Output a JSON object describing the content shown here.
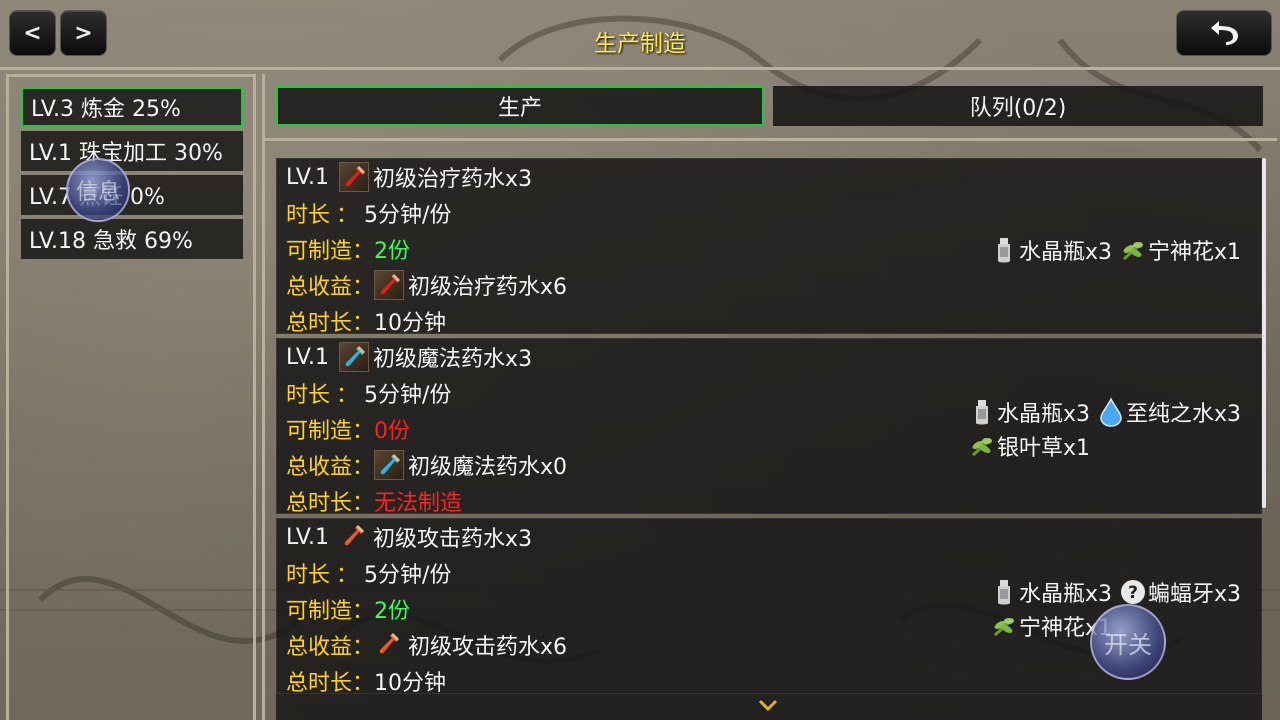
{
  "header": {
    "title": "生产制造",
    "prev_label": "<",
    "next_label": ">",
    "back_icon": "undo-arrow-icon"
  },
  "sidebar": {
    "items": [
      {
        "label": "LV.3 炼金 25%",
        "active": true
      },
      {
        "label": "LV.1 珠宝加工 30%",
        "active": false
      },
      {
        "label": "LV.7 烹饪 0%",
        "active": false
      },
      {
        "label": "LV.18 急救 69%",
        "active": false
      }
    ],
    "info_bubble_label": "信息"
  },
  "tabs": {
    "produce": "生产",
    "queue": "队列(0/2)"
  },
  "labels": {
    "duration": "时长",
    "colon_spaced": "：",
    "craftable": "可制造：",
    "total_yield": "总收益：",
    "total_time": "总时长："
  },
  "recipes": [
    {
      "level": "LV.1",
      "name": "初级治疗药水x3",
      "duration": "5分钟/份",
      "craftable": "2份",
      "yield": "初级治疗药水x6",
      "total_time": "10分钟",
      "icon": "red-potion-icon",
      "materials": [
        {
          "name": "水晶瓶x3",
          "icon": "crystal-vial-icon"
        },
        {
          "name": "宁神花x1",
          "icon": "herb-icon"
        }
      ]
    },
    {
      "level": "LV.1",
      "name": "初级魔法药水x3",
      "duration": "5分钟/份",
      "craftable": "0份",
      "yield": "初级魔法药水x0",
      "total_time": "无法制造",
      "icon": "blue-potion-icon",
      "materials": [
        {
          "name": "水晶瓶x3",
          "icon": "crystal-vial-icon"
        },
        {
          "name": "至纯之水x3",
          "icon": "water-drop-icon"
        },
        {
          "name": "银叶草x1",
          "icon": "herb-icon"
        }
      ]
    },
    {
      "level": "LV.1",
      "name": "初级攻击药水x3",
      "duration": "5分钟/份",
      "craftable": "2份",
      "yield": "初级攻击药水x6",
      "total_time": "10分钟",
      "icon": "orange-potion-icon",
      "materials": [
        {
          "name": "水晶瓶x3",
          "icon": "crystal-vial-icon"
        },
        {
          "name": "蝙蝠牙x3",
          "icon": "question-mark-icon"
        },
        {
          "name": "宁神花x1",
          "icon": "herb-icon"
        }
      ]
    }
  ],
  "toggle_label": "开关",
  "colors": {
    "title": "#ffe84a",
    "label": "#ffd21f",
    "ok": "#3cff5a",
    "error": "#ff2020",
    "active_border": "#21c93a"
  }
}
